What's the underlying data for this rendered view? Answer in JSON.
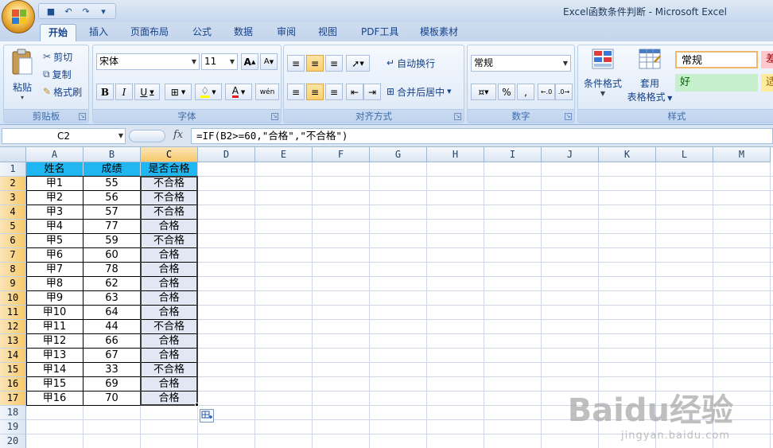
{
  "window": {
    "title": "Excel函数条件判断 - Microsoft Excel"
  },
  "tabs": [
    "开始",
    "插入",
    "页面布局",
    "公式",
    "数据",
    "审阅",
    "视图",
    "PDF工具",
    "模板素材"
  ],
  "clipboard": {
    "paste": "粘贴",
    "cut": "剪切",
    "copy": "复制",
    "format_painter": "格式刷",
    "label": "剪贴板"
  },
  "font": {
    "name": "宋体",
    "size": "11",
    "label": "字体",
    "bold": "B",
    "italic": "I",
    "underline": "U",
    "grow": "A",
    "shrink": "A",
    "color_a": "A",
    "phonetic": "wén"
  },
  "alignment": {
    "wrap_text": "自动换行",
    "merge_center": "合并后居中",
    "label": "对齐方式"
  },
  "number": {
    "format": "常规",
    "percent": "%",
    "comma": ",",
    "label": "数字"
  },
  "styles": {
    "conditional_format": "条件格式",
    "format_as_table_1": "套用",
    "format_as_table_2": "表格格式",
    "normal": "常规",
    "bad": "差",
    "good": "好",
    "neutral": "适",
    "label": "样式"
  },
  "formula_bar": {
    "name_box": "C2",
    "fx": "fx",
    "formula": "=IF(B2>=60,\"合格\",\"不合格\")"
  },
  "sheet": {
    "columns": [
      "A",
      "B",
      "C",
      "D",
      "E",
      "F",
      "G",
      "H",
      "I",
      "J",
      "K",
      "L",
      "M"
    ],
    "rows": [
      "1",
      "2",
      "3",
      "4",
      "5",
      "6",
      "7",
      "8",
      "9",
      "10",
      "11",
      "12",
      "13",
      "14",
      "15",
      "16",
      "17",
      "18",
      "19",
      "20"
    ],
    "header": [
      "姓名",
      "成绩",
      "是否合格"
    ],
    "data": [
      [
        "甲1",
        "55",
        "不合格"
      ],
      [
        "甲2",
        "56",
        "不合格"
      ],
      [
        "甲3",
        "57",
        "不合格"
      ],
      [
        "甲4",
        "77",
        "合格"
      ],
      [
        "甲5",
        "59",
        "不合格"
      ],
      [
        "甲6",
        "60",
        "合格"
      ],
      [
        "甲7",
        "78",
        "合格"
      ],
      [
        "甲8",
        "62",
        "合格"
      ],
      [
        "甲9",
        "63",
        "合格"
      ],
      [
        "甲10",
        "64",
        "合格"
      ],
      [
        "甲11",
        "44",
        "不合格"
      ],
      [
        "甲12",
        "66",
        "合格"
      ],
      [
        "甲13",
        "67",
        "合格"
      ],
      [
        "甲14",
        "33",
        "不合格"
      ],
      [
        "甲15",
        "69",
        "合格"
      ],
      [
        "甲16",
        "70",
        "合格"
      ]
    ],
    "header_fill": "#1fb6f2"
  },
  "watermark": {
    "main": "Baidu经验",
    "sub": "jingyan.baidu.com"
  }
}
